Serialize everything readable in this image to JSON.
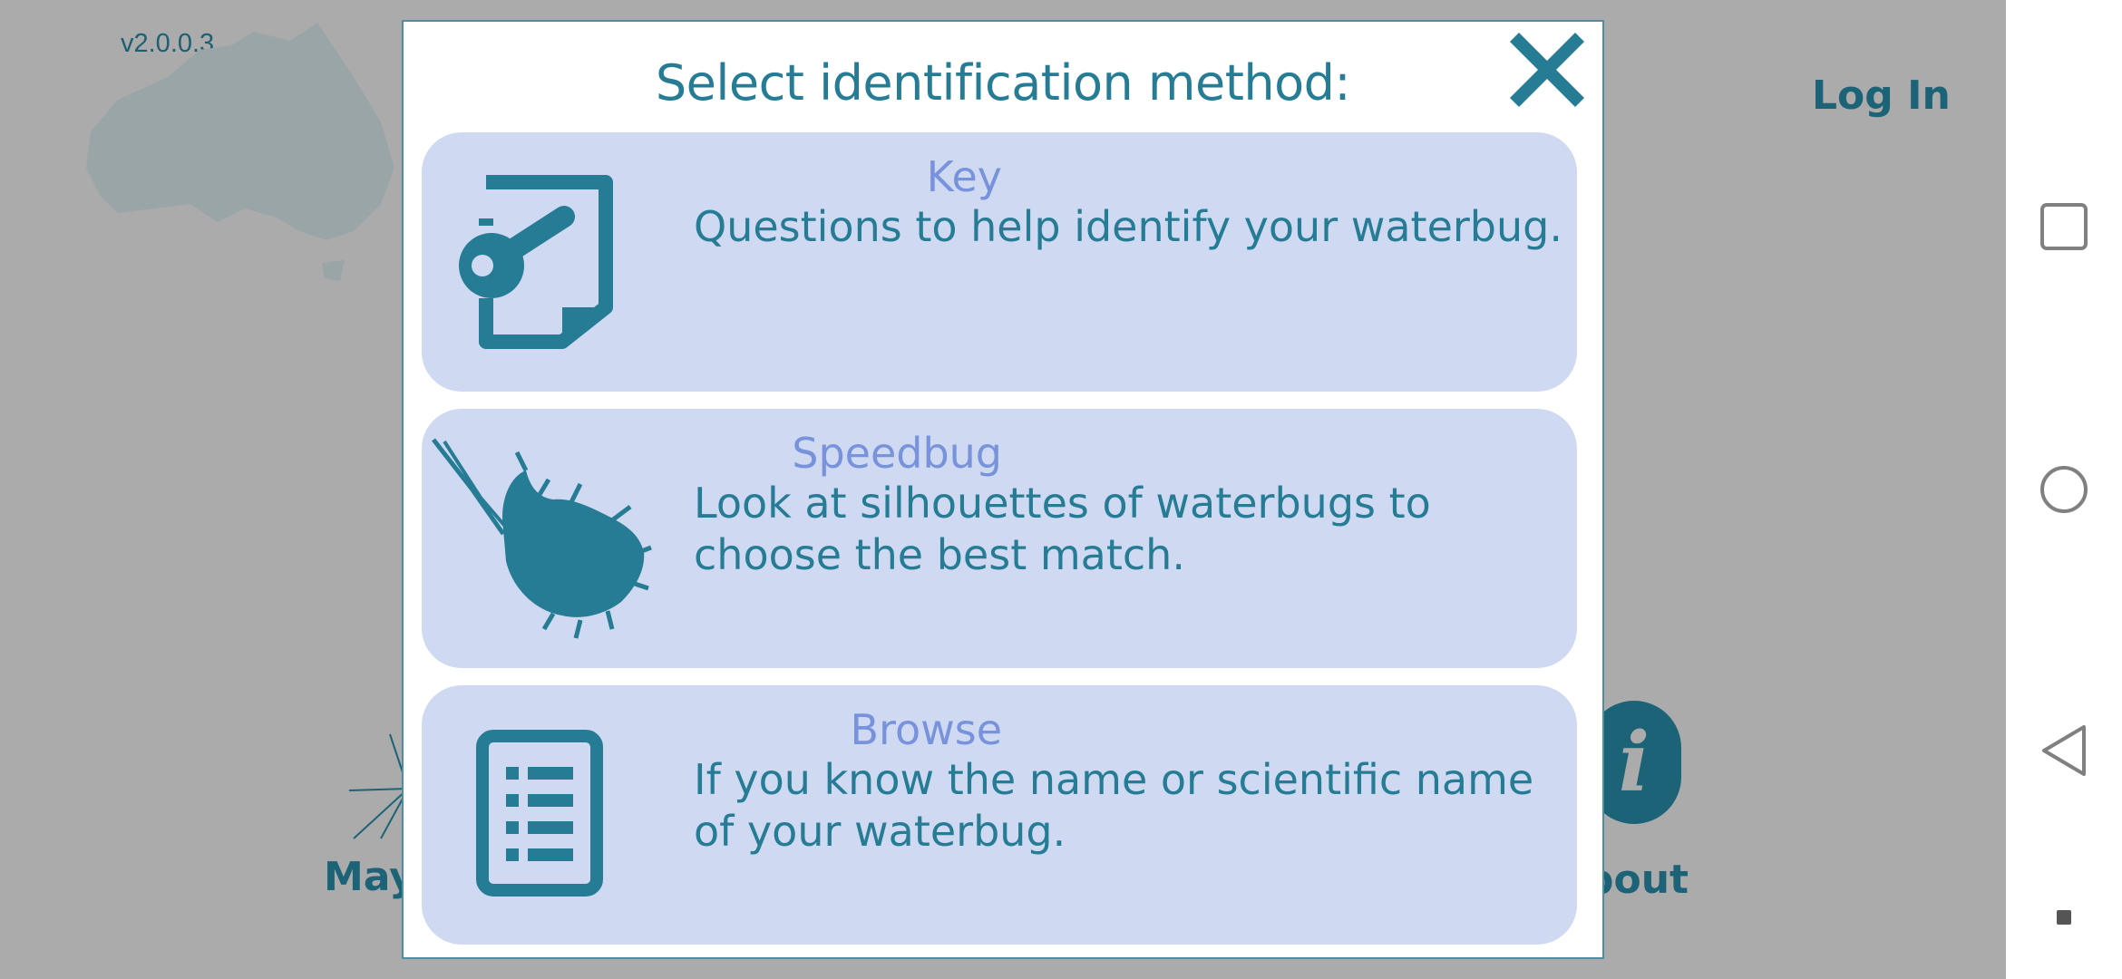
{
  "app": {
    "version": "v2.0.0.3",
    "login_label": "Log In",
    "about_icon": "i",
    "about_label": "bout",
    "left_label": "May"
  },
  "dialog": {
    "title": "Select identification method:",
    "close_icon": "close-icon",
    "options": [
      {
        "title": "Key",
        "description": "Questions to help identify your waterbug.",
        "icon": "key-document-icon"
      },
      {
        "title": "Speedbug",
        "description": "Look at silhouettes of waterbugs to choose the best match.",
        "icon": "waterbug-silhouette-icon"
      },
      {
        "title": "Browse",
        "description": "If you know the name or scientific name of your waterbug.",
        "icon": "list-document-icon"
      }
    ]
  },
  "navbar": {
    "items": [
      "recents-icon",
      "home-icon",
      "back-icon",
      "dot-indicator-icon"
    ]
  },
  "colors": {
    "overlay_gray": "#ababab",
    "accent_teal": "#257c94",
    "dark_teal": "#1c6378",
    "option_bg": "#cfdaf2",
    "option_title": "#7893dc"
  }
}
